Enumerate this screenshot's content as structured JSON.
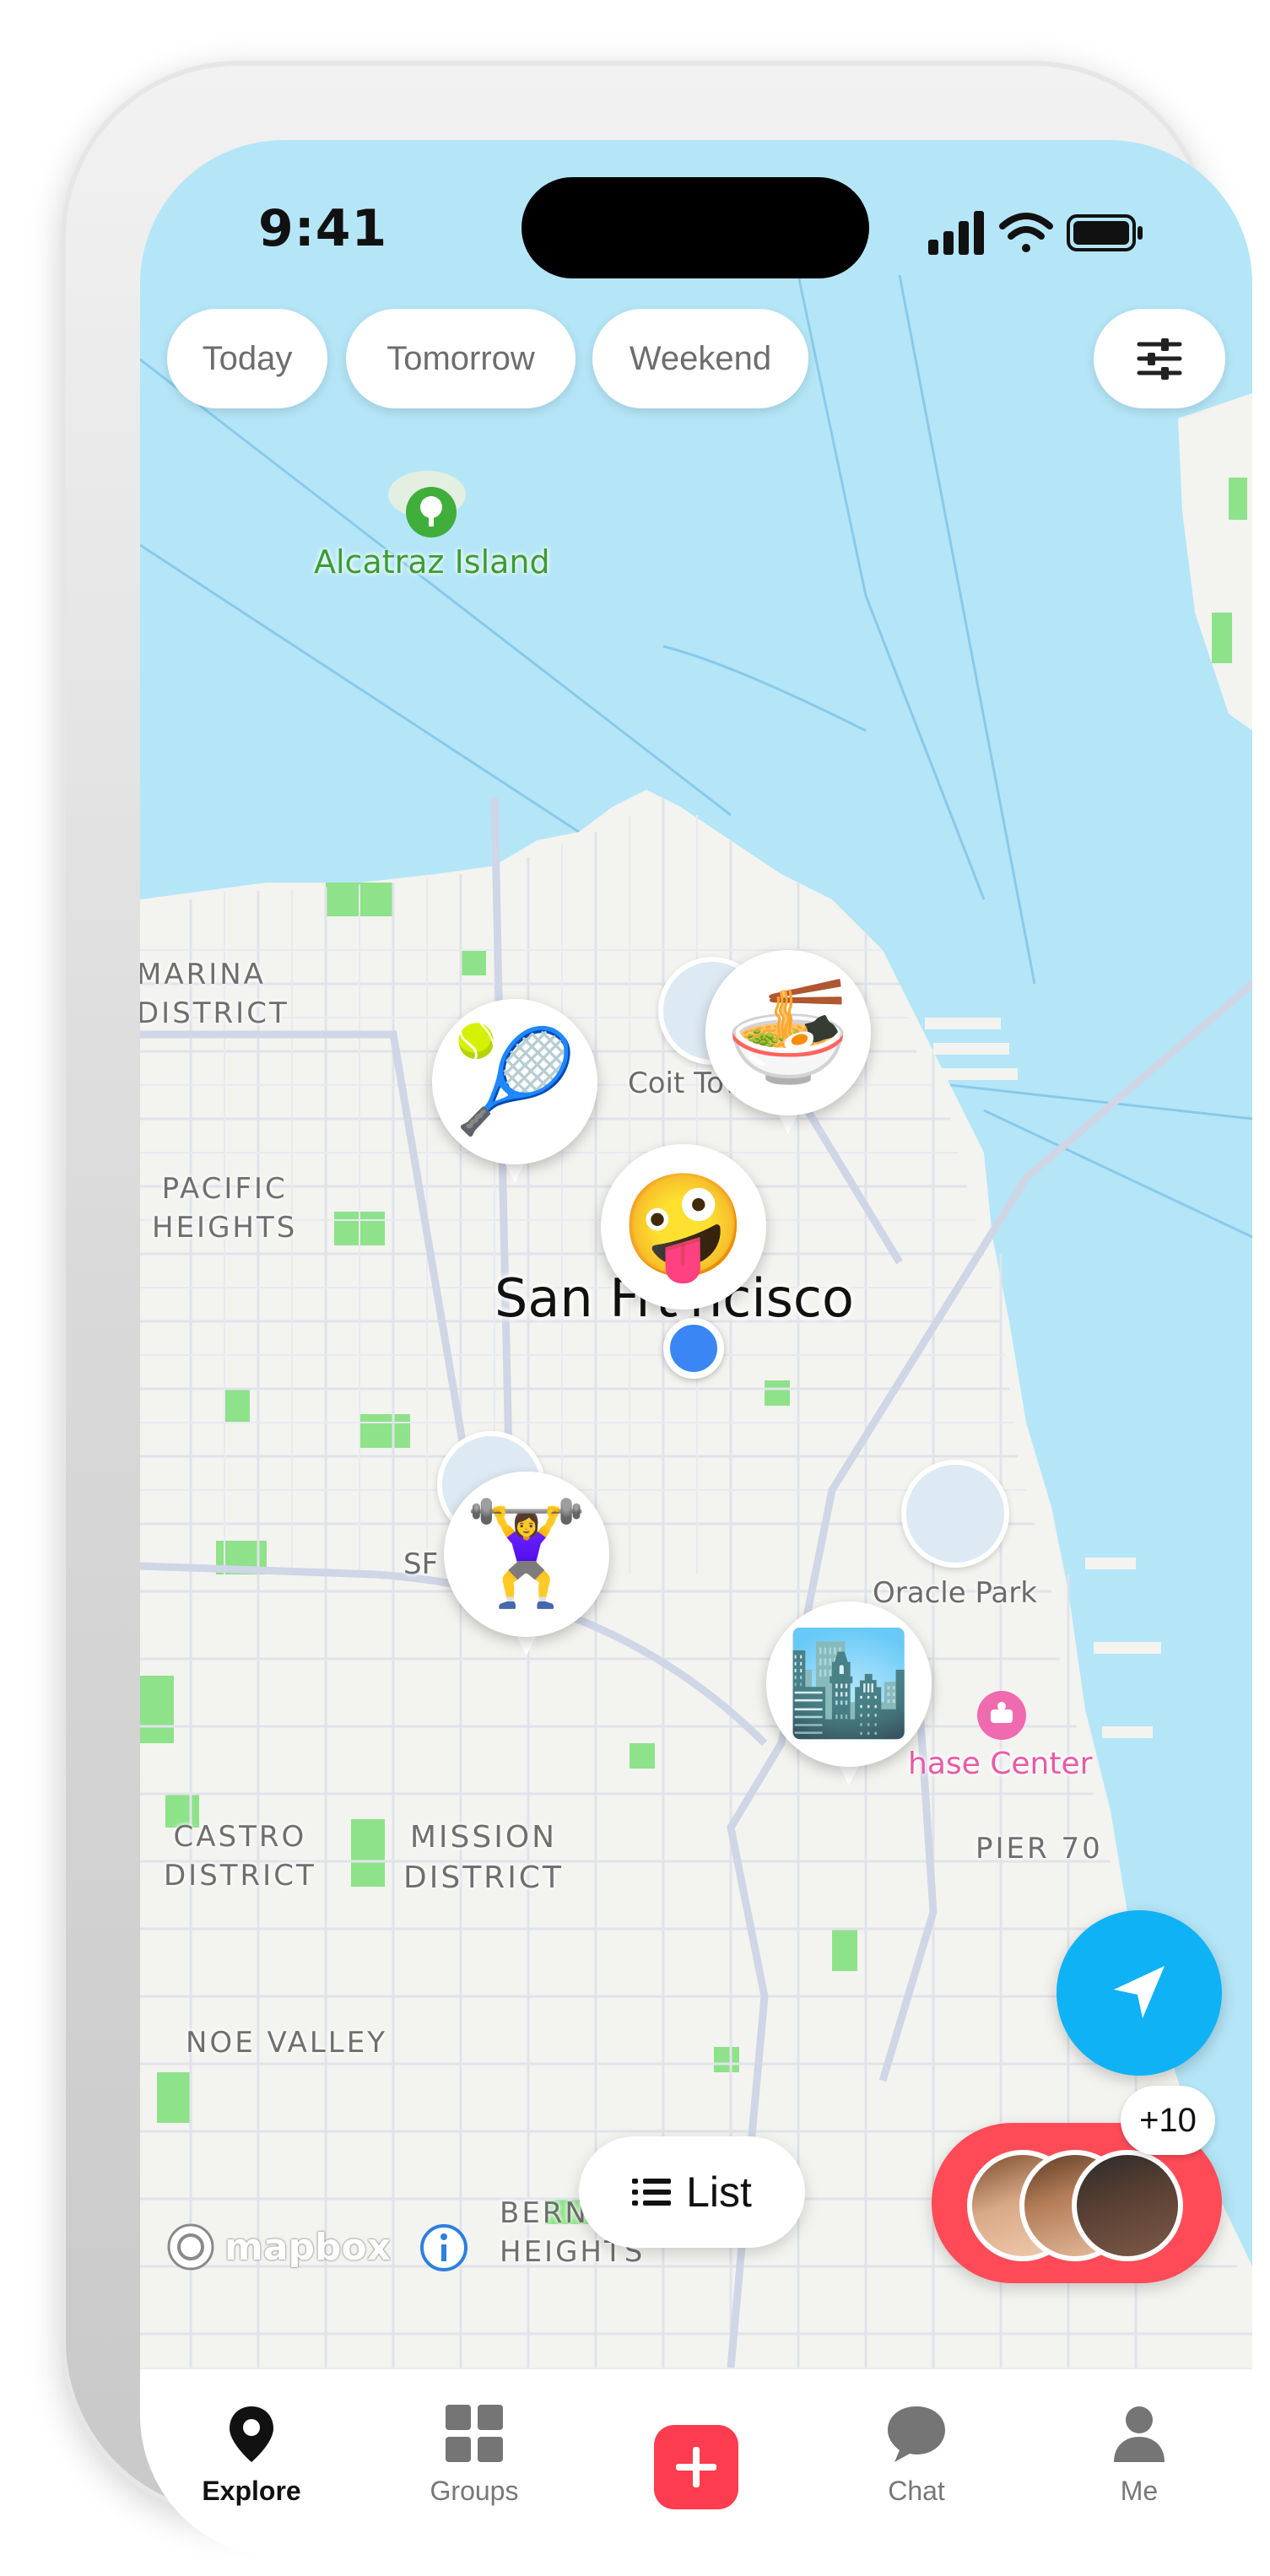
{
  "status_bar": {
    "time": "9:41"
  },
  "filters": {
    "chips": [
      {
        "label": "Today"
      },
      {
        "label": "Tomorrow"
      },
      {
        "label": "Weekend"
      }
    ],
    "filter_icon": "sliders-icon"
  },
  "map": {
    "provider_logo": "mapbox",
    "city": "San Francisco",
    "places": {
      "alcatraz": "Alcatraz Island",
      "coit": "Coit Tow",
      "oracle": "Oracle Park",
      "chase": "hase Center",
      "sf": "SF",
      "pier": "PIER 70"
    },
    "districts": {
      "marina_1": "MARINA",
      "marina_2": "DISTRICT",
      "pacific_1": "PACIFIC",
      "pacific_2": "HEIGHTS",
      "castro_1": "CASTRO",
      "castro_2": "DISTRICT",
      "mission_1": "MISSION",
      "mission_2": "DISTRICT",
      "noe": "NOE VALLEY",
      "bernal_1": "BERNA",
      "bernal_2": "HEIGHTS"
    },
    "event_pins": [
      {
        "emoji": "🎾",
        "name": "tennis"
      },
      {
        "emoji": "🍜",
        "name": "ramen"
      },
      {
        "emoji": "🤪",
        "name": "zany-face"
      },
      {
        "emoji": "🏋️‍♀️",
        "name": "weightlifting"
      },
      {
        "emoji": "🏙️",
        "name": "cityscape"
      }
    ]
  },
  "list_button": {
    "label": "List",
    "icon": "list-icon"
  },
  "locate_button": {
    "icon": "navigation-arrow-icon"
  },
  "friends": {
    "count_label": "+10"
  },
  "tabbar": {
    "tabs": [
      {
        "label": "Explore",
        "icon": "map-pin-icon"
      },
      {
        "label": "Groups",
        "icon": "grid-icon"
      },
      {
        "label": "Chat",
        "icon": "chat-bubble-icon"
      },
      {
        "label": "Me",
        "icon": "person-icon"
      }
    ],
    "add_icon": "plus-icon"
  },
  "colors": {
    "water": "#b4e6f7",
    "land": "#f3f3f0",
    "park": "#8ee28a",
    "accent_red": "#fd3c4f",
    "accent_blue": "#0fb2f5",
    "user_location": "#3a86f4"
  }
}
